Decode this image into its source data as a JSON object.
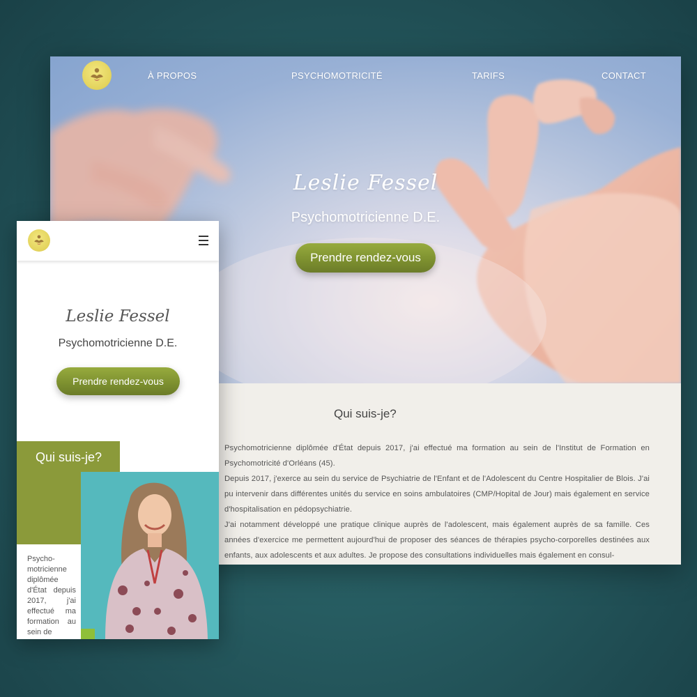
{
  "site": {
    "nav": {
      "logo_alt": "logo",
      "links": [
        "À PROPOS",
        "PSYCHOMOTRICITÉ",
        "TARIFS",
        "CONTACT"
      ]
    },
    "hero": {
      "name": "Leslie Fessel",
      "subtitle": "Psychomotricienne D.E.",
      "cta": "Prendre rendez-vous"
    },
    "about": {
      "title": "Qui suis-je?",
      "paragraphs": [
        "Psychomotricienne diplômée d'État depuis 2017, j'ai effectué ma formation au sein de l'Institut de Formation en Psychomotricité d'Orléans (45).",
        "Depuis 2017, j'exerce au sein du service de Psychiatrie de l'Enfant et de l'Adolescent du Centre Hospitalier de Blois. J'ai pu intervenir dans différentes unités du service en soins ambulatoires (CMP/Hopital de Jour) mais également en service d'hospitalisation en pédopsychiatrie.",
        "J'ai notamment développé une pratique clinique auprès de l'adolescent, mais également auprès de sa famille. Ces années d'exercice me permettent aujourd'hui de proposer des séances de thérapies psycho-corporelles destinées aux enfants, aux adolescents et aux adultes. Je propose des consultations individuelles mais également en consul-"
      ]
    }
  },
  "mobile": {
    "name": "Leslie Fessel",
    "subtitle": "Psychomotricienne D.E.",
    "cta": "Prendre rendez-vous",
    "about_title": "Qui suis-je?",
    "about_text": "Psycho-motricienne diplômée d'État depuis 2017, j'ai effectué ma formation au sein de"
  },
  "colors": {
    "accent_green": "#8b9a3a",
    "logo_yellow": "#e3d35c",
    "background": "#275d62"
  }
}
